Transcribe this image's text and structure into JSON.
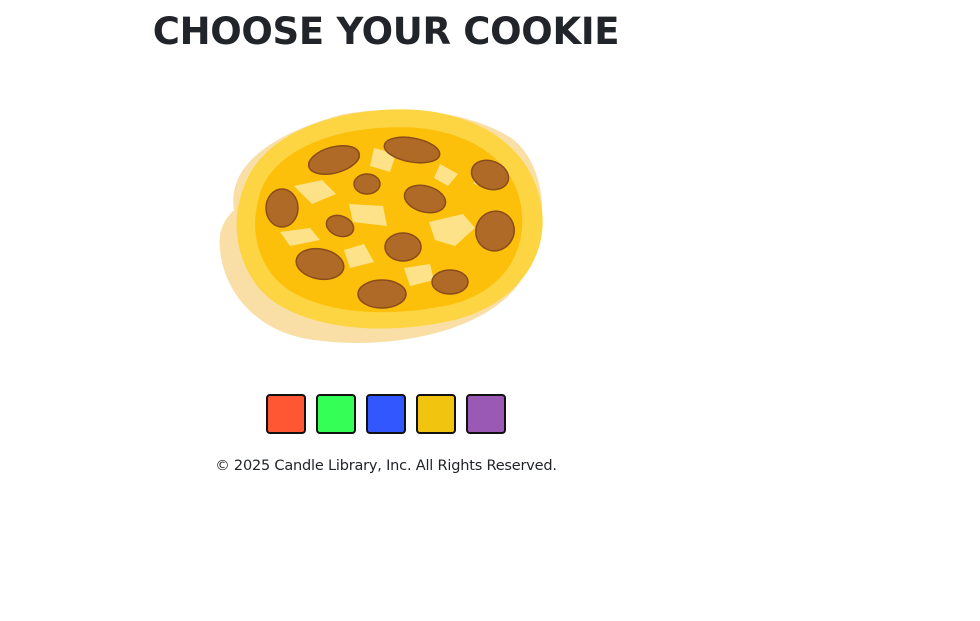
{
  "page": {
    "title": "CHOOSE YOUR COOKIE"
  },
  "cookie": {
    "icon": "cookie-icon",
    "colors": {
      "shadow": "#f9dfa6",
      "rim": "#fdd442",
      "body": "#fcc00a",
      "highlight": "#fde28a",
      "chip": "#b06a28",
      "chip_dark": "#8a4c18"
    }
  },
  "color_options": [
    {
      "name": "red",
      "color": "#ff5733"
    },
    {
      "name": "green",
      "color": "#33ff57"
    },
    {
      "name": "blue",
      "color": "#3357ff"
    },
    {
      "name": "yellow",
      "color": "#f1c40f"
    },
    {
      "name": "purple",
      "color": "#9b59b6"
    }
  ],
  "footer": {
    "copyright": "© 2025 Candle Library, Inc. All Rights Reserved."
  }
}
